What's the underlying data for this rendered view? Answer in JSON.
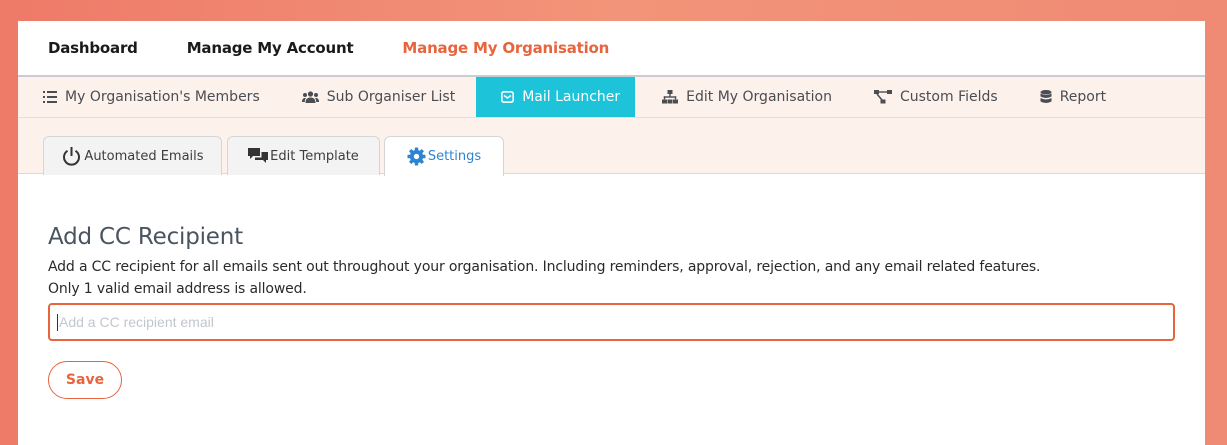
{
  "topnav": {
    "items": [
      "Dashboard",
      "Manage My Account",
      "Manage My Organisation"
    ],
    "active": 2,
    "active_color": "#e8643d"
  },
  "subnav": {
    "items": [
      {
        "label": "My Organisation's Members",
        "icon": "list-icon"
      },
      {
        "label": "Sub Organiser List",
        "icon": "users-icon"
      },
      {
        "label": "Mail Launcher",
        "icon": "envelope-icon"
      },
      {
        "label": "Edit My Organisation",
        "icon": "sitemap-icon"
      },
      {
        "label": "Custom Fields",
        "icon": "diagram-icon"
      },
      {
        "label": "Report",
        "icon": "database-icon"
      }
    ],
    "active": 2,
    "active_color": "#1cc3d9"
  },
  "tabs": {
    "items": [
      {
        "label": "Automated Emails",
        "icon": "power-icon"
      },
      {
        "label": "Edit Template",
        "icon": "comments-icon"
      },
      {
        "label": "Settings",
        "icon": "gear-icon"
      }
    ],
    "active": 2
  },
  "settings": {
    "heading": "Add CC Recipient",
    "description_line1": "Add a CC recipient for all emails sent out throughout your organisation. Including reminders, approval, rejection, and any email related features.",
    "description_line2": "Only 1 valid email address is allowed.",
    "input_placeholder": "Add a CC recipient email",
    "input_value": "",
    "save_label": "Save"
  }
}
